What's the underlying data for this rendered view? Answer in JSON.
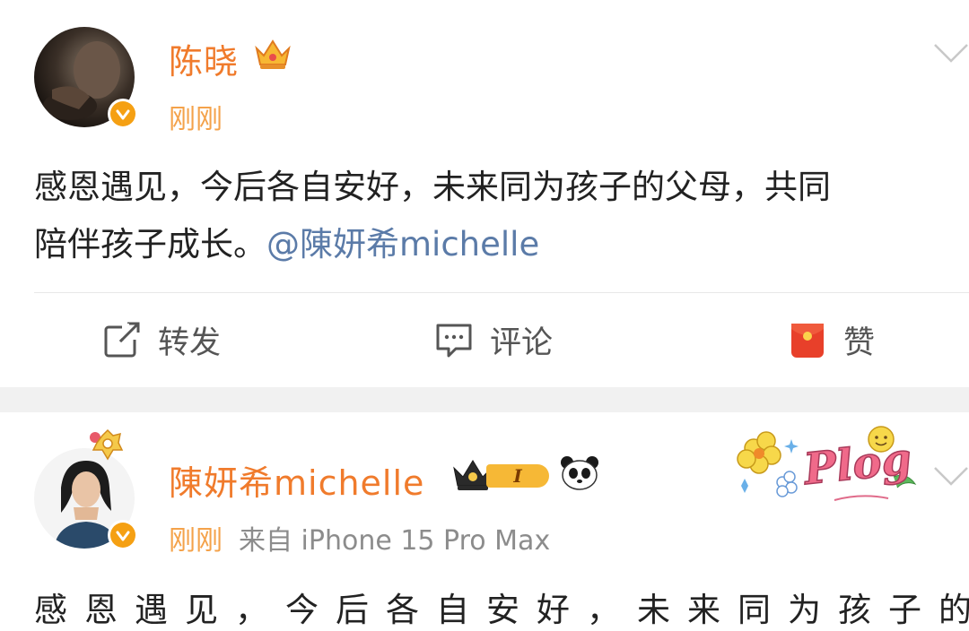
{
  "colors": {
    "name": "#f07b2c",
    "time": "#f4a24a",
    "mention": "#5b7ba8",
    "verified": "#f5a013",
    "separator": "#f1f1f1"
  },
  "post1": {
    "author": "陈晓",
    "badge_icon": "crown-icon",
    "time": "刚刚",
    "text_line1": "感恩遇见，今后各自安好，未来同为孩子的父母，共同",
    "text_line2": "陪伴孩子成长。",
    "mention": "@陳妍希michelle",
    "actions": {
      "repost": "转发",
      "comment": "评论",
      "like": "赞"
    }
  },
  "post2": {
    "author": "陳妍希michelle",
    "level": "I",
    "badge_icon": "crown-level-icon",
    "emoji_icon": "panda-icon",
    "sticker": "Plog",
    "time": "刚刚",
    "source": "来自 iPhone 15 Pro Max",
    "text": "感恩遇见，今后各自安好，未来同为孩子的"
  }
}
